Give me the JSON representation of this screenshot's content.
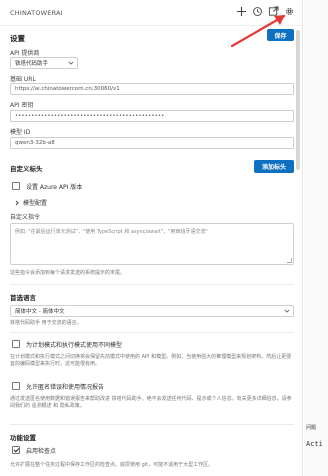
{
  "titlebar": {
    "title": "CHINATOWERAI",
    "icons": [
      "plus-icon",
      "history-icon",
      "open-editor-icon",
      "gear-icon"
    ]
  },
  "settings": {
    "heading": "设置",
    "save_label": "保存",
    "api_provider_label": "API 提供商",
    "api_provider_value": "铁塔代码助手",
    "base_url_label": "基础 URL",
    "base_url_value": "https://ai.chinatowercom.cn:30060/v1",
    "api_key_label": "API 密钥",
    "api_key_value": "••••••••••••••••••••••••••••••••••••••••••••••",
    "model_id_label": "模型 ID",
    "model_id_value": "qwen3-32b-a8"
  },
  "custom_headers": {
    "heading": "自定义标头",
    "add_button": "添加标头",
    "azure_checkbox_label": "设置 Azure API 版本",
    "model_config_label": "模型配置"
  },
  "custom_instructions": {
    "label": "自定义指令",
    "placeholder": "例如: \"在最后运行单元测试\"，\"使用 TypeScript 和 async/await\"，\"用西班牙语交流\"",
    "help": "这些指令会添加到每个请求发送的系统提示的末尾。"
  },
  "preferred_language": {
    "heading": "首选语言",
    "value": "简体中文 - 简体中文",
    "help": "铁塔代码助手 用于交流的语言。"
  },
  "plan_act": {
    "checkbox_label": "为计划模式和执行模式使用不同模型",
    "help": "在计划模式和执行模式之间切换将会保留先前模式中使用的 API 和模型。例如，当使用强大的推理模型来规划架构，然后让更便宜的编码模型来执行时，这可能很有用。"
  },
  "telemetry": {
    "checkbox_label": "允许匿名错误和使用情况报告",
    "help": "通过发送匿名使用数据和错误报告来帮助改进 铁塔代码助手。绝不会发送任何代码、提示或个人信息。有关更多详细信息，请参阅我们的 遥测概述 和 隐私政策。"
  },
  "features": {
    "heading": "功能设置",
    "checkpoints_label": "启用检查点",
    "checkpoints_help": "允许扩展在整个任务过程中保存工作区的检查点。底层使用 git，可能不适用于大型工作区。"
  },
  "side_panel": {
    "label1": "问题",
    "label2": "Acti"
  }
}
